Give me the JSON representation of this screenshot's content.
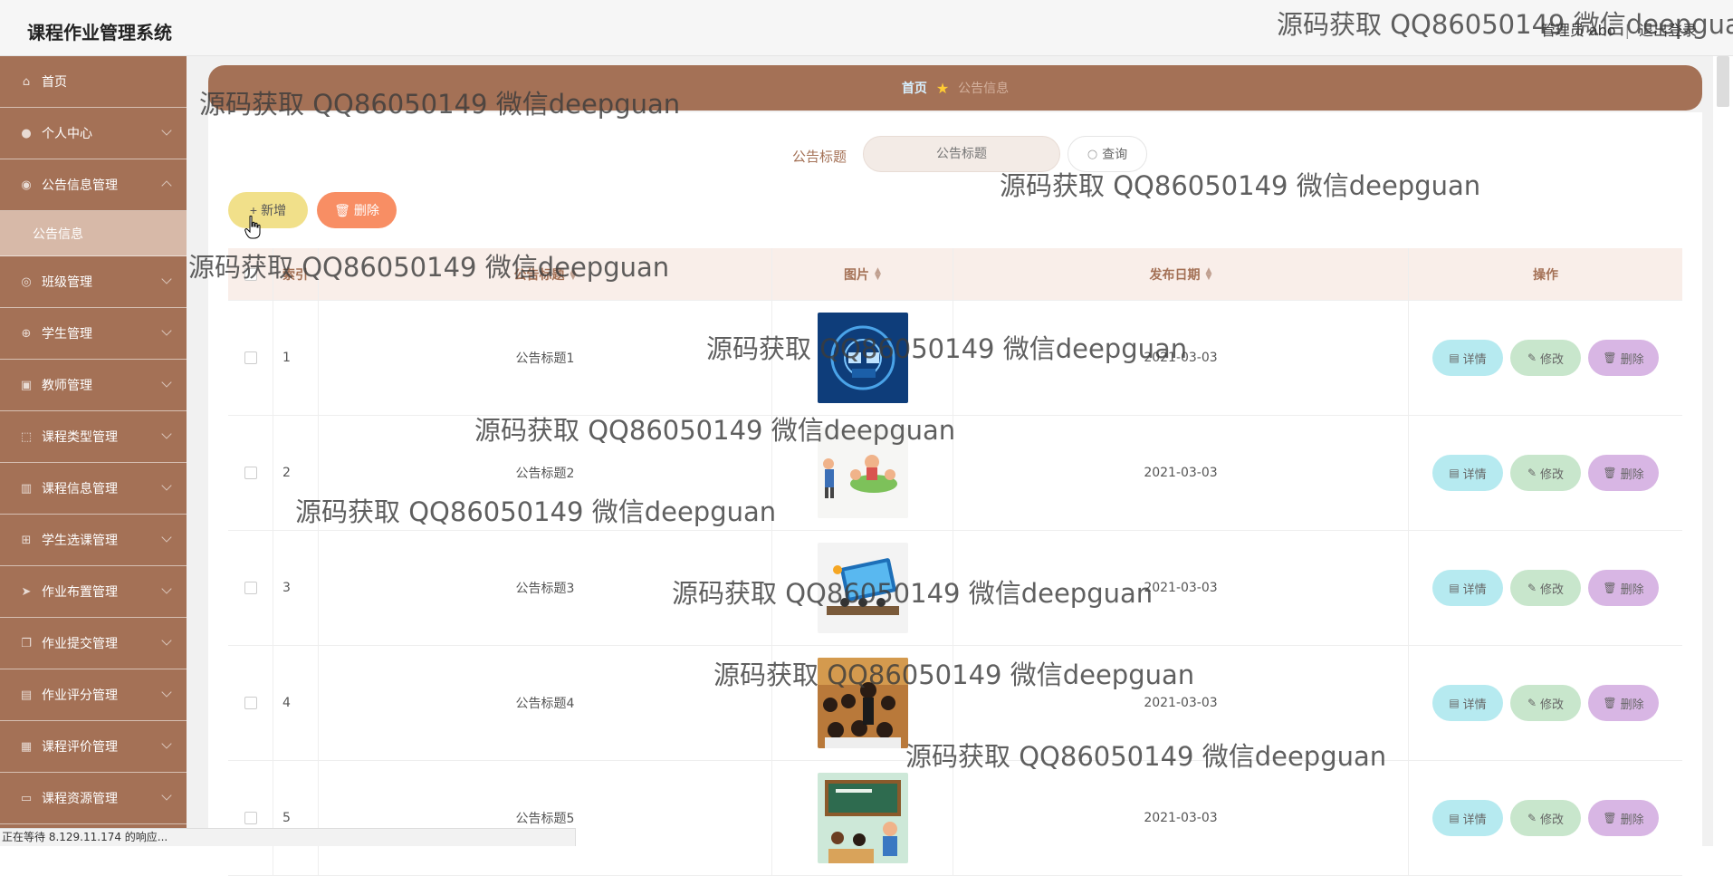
{
  "app": {
    "title": "课程作业管理系统",
    "user_label": "管理员 abo",
    "logout": "退出登录"
  },
  "sidebar": {
    "items": [
      {
        "label": "首页",
        "icon": "home-icon"
      },
      {
        "label": "个人中心",
        "icon": "user-icon"
      },
      {
        "label": "公告信息管理",
        "icon": "location-icon"
      },
      {
        "label": "公告信息",
        "icon": ""
      },
      {
        "label": "班级管理",
        "icon": "globe-icon"
      },
      {
        "label": "学生管理",
        "icon": "target-icon"
      },
      {
        "label": "教师管理",
        "icon": "wallet-icon"
      },
      {
        "label": "课程类型管理",
        "icon": "frame-icon"
      },
      {
        "label": "课程信息管理",
        "icon": "bar-chart-icon"
      },
      {
        "label": "学生选课管理",
        "icon": "grid-icon"
      },
      {
        "label": "作业布置管理",
        "icon": "send-icon"
      },
      {
        "label": "作业提交管理",
        "icon": "copy-icon"
      },
      {
        "label": "作业评分管理",
        "icon": "briefcase-icon"
      },
      {
        "label": "课程评价管理",
        "icon": "box-icon"
      },
      {
        "label": "课程资源管理",
        "icon": "monitor-icon"
      }
    ]
  },
  "breadcrumb": {
    "home": "首页",
    "current": "公告信息"
  },
  "search": {
    "label": "公告标题",
    "placeholder": "公告标题",
    "button": "查询"
  },
  "toolbar": {
    "add": "新增",
    "delete": "删除"
  },
  "table": {
    "headers": {
      "index": "索引",
      "title": "公告标题",
      "image": "图片",
      "date": "发布日期",
      "ops": "操作"
    },
    "rows": [
      {
        "index": "1",
        "title": "公告标题1",
        "date": "2021-03-03"
      },
      {
        "index": "2",
        "title": "公告标题2",
        "date": "2021-03-03"
      },
      {
        "index": "3",
        "title": "公告标题3",
        "date": "2021-03-03"
      },
      {
        "index": "4",
        "title": "公告标题4",
        "date": "2021-03-03"
      },
      {
        "index": "5",
        "title": "公告标题5",
        "date": "2021-03-03"
      }
    ],
    "ops": {
      "detail": "详情",
      "edit": "修改",
      "delete": "删除"
    }
  },
  "status_bar": "正在等待 8.129.11.174 的响应...",
  "watermark": "源码获取 QQ86050149 微信deepguan",
  "colors": {
    "sidebar": "#a47156",
    "accent": "#a47156",
    "add_button": "#f1e08a",
    "delete_button": "#f88e64",
    "detail_button": "#b6eaf0",
    "edit_button": "#c8e6cc",
    "row_delete_button": "#d8b6e4"
  }
}
